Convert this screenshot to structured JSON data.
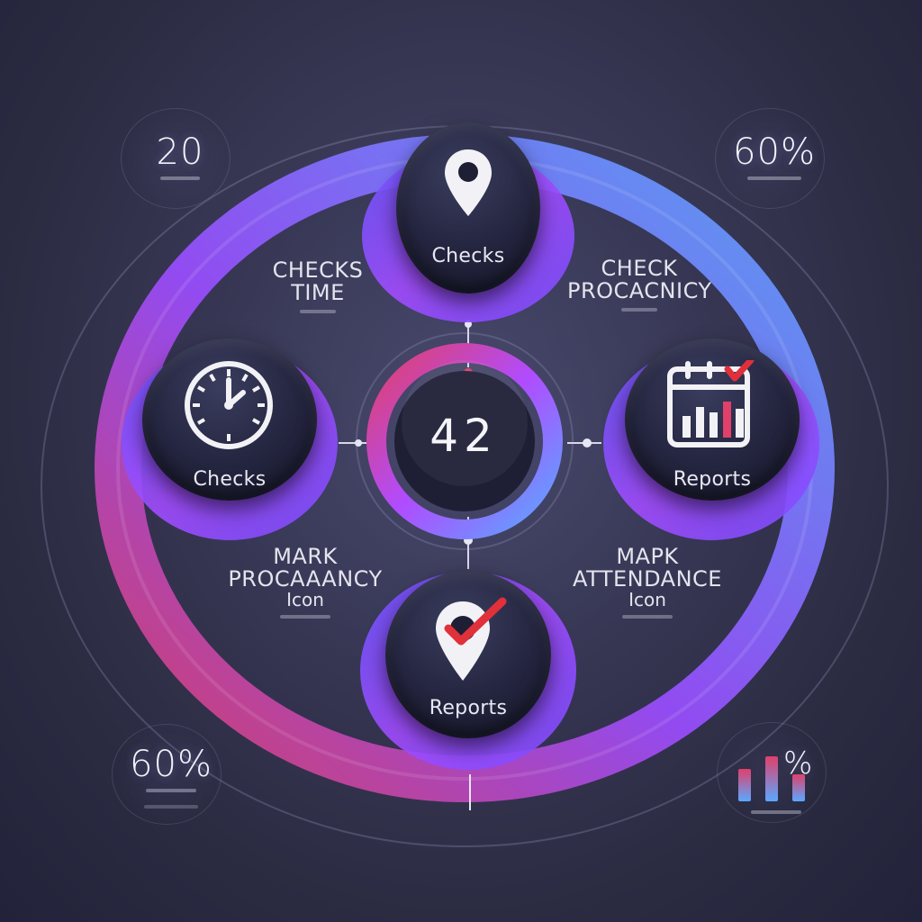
{
  "colors": {
    "accent_pink": "#e0406a",
    "accent_purple": "#9a4dff",
    "accent_blue": "#5aa8ff",
    "check_red": "#e0303a",
    "button_dark": "#1e1f35"
  },
  "center": {
    "value": "42"
  },
  "nodes": {
    "top": {
      "label": "Checks",
      "icon": "location-pin-icon"
    },
    "left": {
      "label": "Checks",
      "icon": "clock-icon"
    },
    "right": {
      "label": "Reports",
      "icon": "calendar-chart-icon"
    },
    "bottom": {
      "label": "Reports",
      "icon": "location-check-icon"
    }
  },
  "annotations": {
    "top_left": {
      "line1": "CHECKS",
      "line2": "TIME"
    },
    "top_right": {
      "line1": "CHECK",
      "line2": "PROCACNICY"
    },
    "bottom_left": {
      "line1": "MARK",
      "line2": "PROCAAANCY",
      "line3": "Icon"
    },
    "bottom_right": {
      "line1": "MAPK",
      "line2": "ATTENDANCE",
      "line3": "Icon"
    }
  },
  "stats": {
    "top_left": {
      "value": "20"
    },
    "top_right": {
      "value": "60%"
    },
    "bottom_left": {
      "value": "60%"
    },
    "bottom_right": {
      "value": "%"
    }
  }
}
